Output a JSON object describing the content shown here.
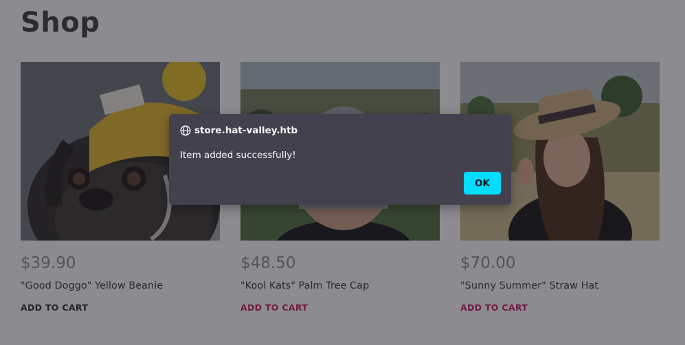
{
  "page": {
    "title": "Shop"
  },
  "products": [
    {
      "price": "$39.90",
      "name": "\"Good Doggo\" Yellow Beanie",
      "cta": "ADD TO CART",
      "image": "pug-wearing-yellow-beanie-photo"
    },
    {
      "price": "$48.50",
      "name": "\"Kool Kats\" Palm Tree Cap",
      "cta": "ADD TO CART",
      "image": "man-wearing-grey-cap-park-photo"
    },
    {
      "price": "$70.00",
      "name": "\"Sunny Summer\" Straw Hat",
      "cta": "ADD TO CART",
      "image": "woman-wearing-straw-hat-field-photo"
    }
  ],
  "dialog": {
    "origin": "store.hat-valley.htb",
    "message": "Item added successfully!",
    "ok_label": "OK",
    "icon": "globe-icon"
  },
  "colors": {
    "accent_link": "#c2185b",
    "dialog_bg": "#42414d",
    "ok_button": "#00ddff"
  }
}
